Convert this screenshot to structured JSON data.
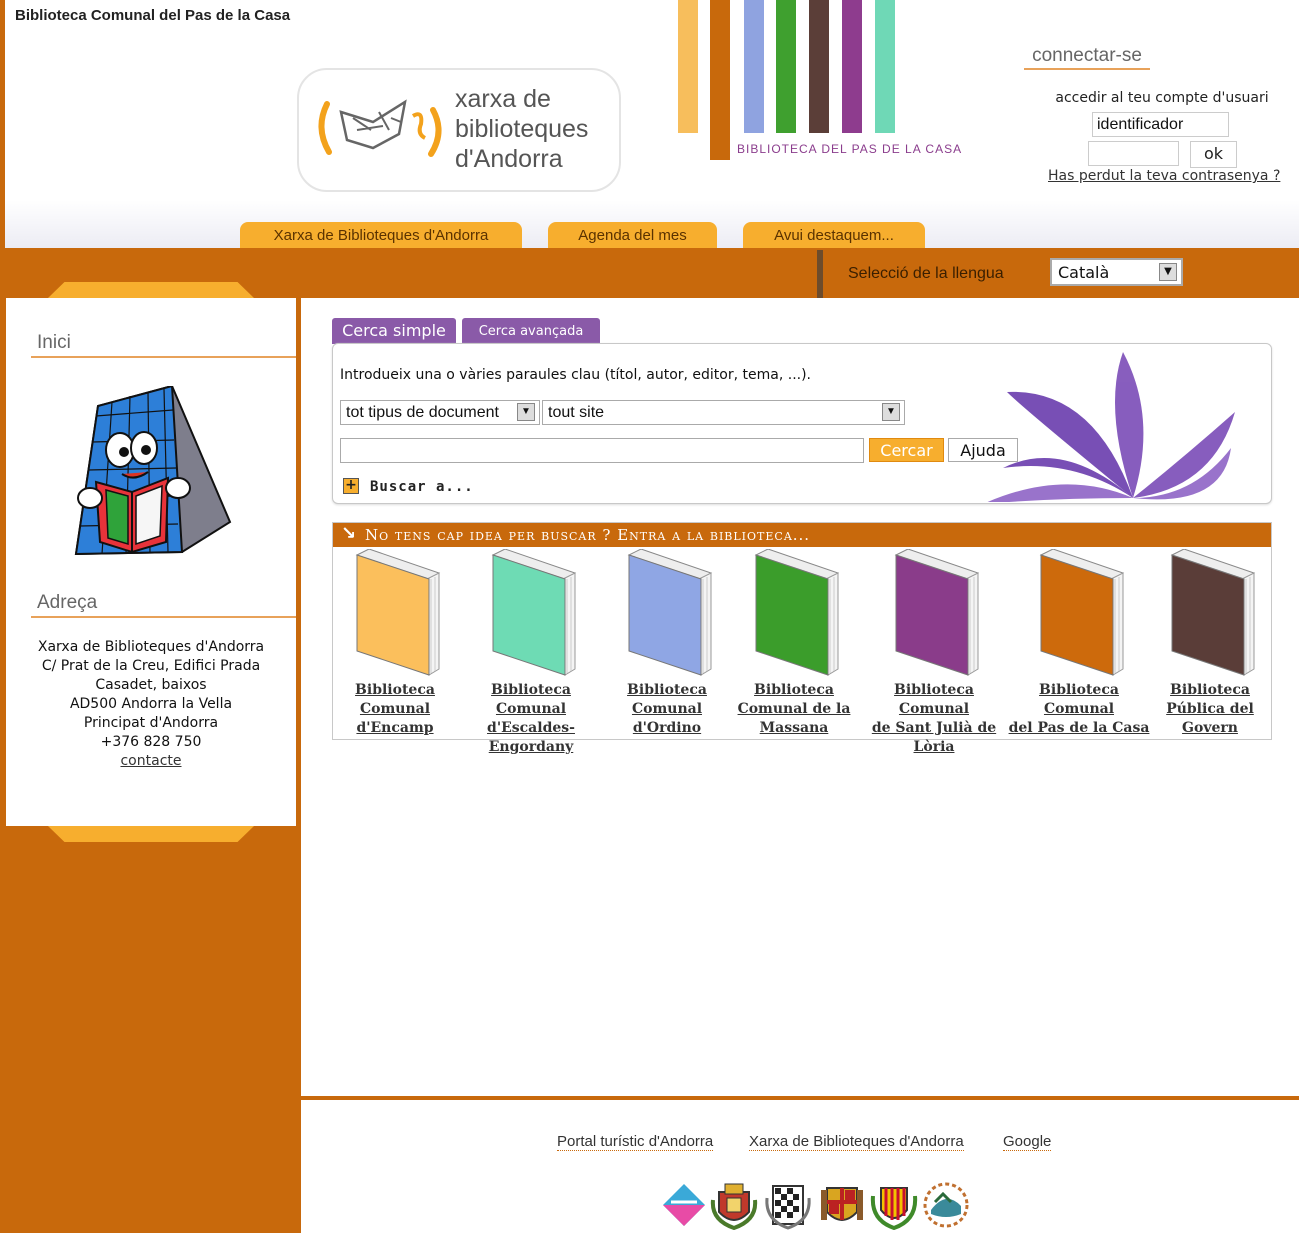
{
  "header": {
    "site_title": "Biblioteca Comunal del Pas de la Casa",
    "logo_text": [
      "xarxa de",
      "biblioteques",
      "d'Andorra"
    ],
    "stripe_caption": "BIBLIOTECA DEL PAS DE LA CASA",
    "stripe_colors": [
      "#f7be5c",
      "#c8690c",
      "#8fa3e0",
      "#3fa02f",
      "#5b3e38",
      "#8e3c8e",
      "#6fd8b6"
    ]
  },
  "login": {
    "title": "connectar-se",
    "hint": "accedir al teu compte d'usuari",
    "username_value": "identificador",
    "password_value": "",
    "ok_label": "ok",
    "forgot_link": "Has perdut la teva contrasenya ?"
  },
  "nav": {
    "tabs": [
      {
        "label": "Xarxa de Biblioteques d'Andorra"
      },
      {
        "label": "Agenda del mes"
      },
      {
        "label": "Avui destaquem..."
      }
    ],
    "language_label": "Selecció de la llengua",
    "language_value": "Català"
  },
  "sidebar": {
    "home_title": "Inici",
    "address_title": "Adreça",
    "address_lines": [
      "Xarxa de Biblioteques d'Andorra",
      "C/ Prat de la Creu, Edifici Prada",
      "Casadet, baixos",
      "AD500 Andorra la Vella",
      "Principat d'Andorra",
      "+376 828 750"
    ],
    "contact_link": "contacte"
  },
  "search": {
    "tab_simple": "Cerca simple",
    "tab_advanced": "Cerca avançada",
    "instructions": "Introdueix una o vàries paraules clau (títol, autor, editor, tema, ...).",
    "doc_type_value": "tot tipus de document",
    "site_value": "tout site",
    "query_value": "",
    "search_button": "Cercar",
    "help_button": "Ajuda",
    "expand_label": "Buscar a..."
  },
  "libraries": {
    "heading": "No tens cap idea per buscar ? Entra a la biblioteca...",
    "items": [
      {
        "name": "Biblioteca Comunal d'Encamp",
        "color": "#fbbf5c",
        "lines": [
          "Biblioteca",
          "Comunal",
          "d'Encamp"
        ]
      },
      {
        "name": "Biblioteca Comunal d'Escaldes-Engordany",
        "color": "#6edbb4",
        "lines": [
          "Biblioteca Comunal",
          "d'Escaldes-",
          "Engordany"
        ]
      },
      {
        "name": "Biblioteca Comunal d'Ordino",
        "color": "#8fa6e4",
        "lines": [
          "Biblioteca",
          "Comunal",
          "d'Ordino"
        ]
      },
      {
        "name": "Biblioteca Comunal de la Massana",
        "color": "#3b9d2b",
        "lines": [
          "Biblioteca",
          "Comunal de la",
          "Massana"
        ]
      },
      {
        "name": "Biblioteca Comunal de Sant Julià de Lòria",
        "color": "#8a3c8a",
        "lines": [
          "Biblioteca Comunal",
          "de Sant Julià de",
          "Lòria"
        ]
      },
      {
        "name": "Biblioteca Comunal del Pas de la Casa",
        "color": "#cd6a0c",
        "lines": [
          "Biblioteca Comunal",
          "del Pas de la Casa",
          ""
        ]
      },
      {
        "name": "Biblioteca Pública del Govern",
        "color": "#5a3d38",
        "lines": [
          "Biblioteca",
          "Pública del",
          "Govern"
        ]
      }
    ]
  },
  "footer": {
    "links": [
      {
        "label": "Portal turístic d'Andorra"
      },
      {
        "label": "Xarxa de Biblioteques d'Andorra"
      },
      {
        "label": "Google"
      }
    ],
    "coat_icons": [
      "andorra-tourism-icon",
      "canillo-coat-icon",
      "encamp-coat-icon",
      "ordino-coat-icon",
      "la-massana-coat-icon",
      "escaldes-coat-icon"
    ]
  }
}
